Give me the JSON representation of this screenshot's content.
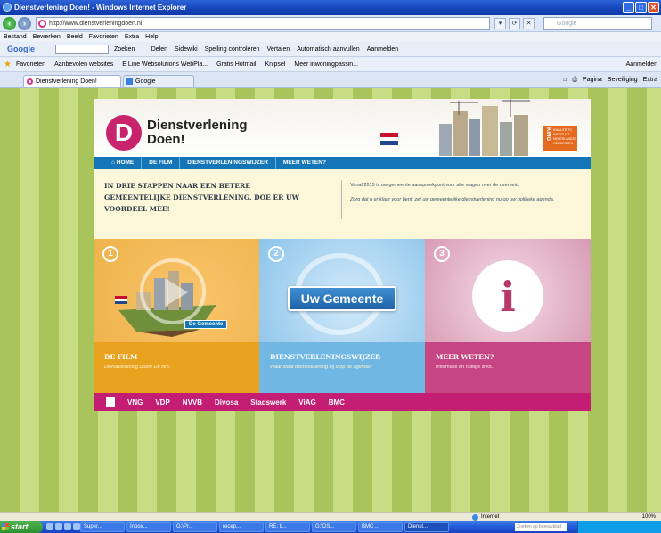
{
  "window": {
    "title": "Dienstverlening Doen! - Windows Internet Explorer",
    "min": "_",
    "max": "□",
    "close": "✕"
  },
  "addressbar": {
    "url": "http://www.dienstverleningdoen.nl",
    "search_placeholder": "Google",
    "buttons": [
      "▾",
      "⟳",
      "✕"
    ]
  },
  "menubar": {
    "items": [
      "Bestand",
      "Bewerken",
      "Beeld",
      "Favorieten",
      "Extra",
      "Help"
    ]
  },
  "google_toolbar": {
    "logo": "Google",
    "items": [
      "Zoeken",
      "·",
      "Delen",
      "Sidewiki",
      "Spelling controleren",
      "Vertalen",
      "Automatisch aanvullen",
      "Aanmelden"
    ]
  },
  "favorites_bar": {
    "label": "Favorieten",
    "items": [
      "Aanbevolen websites",
      "E Line Websolutions WebPla...",
      "Gratis Hotmail",
      "Knipsel",
      "Meer inwoningpassin..."
    ],
    "right_items": [
      "Aanmelden"
    ]
  },
  "tabs": [
    {
      "label": "Dienstverlening Doen!",
      "active": true
    },
    {
      "label": "Google",
      "active": false
    }
  ],
  "command_bar": {
    "items": [
      "Pagina",
      "Beveiliging",
      "Extra"
    ]
  },
  "site": {
    "logo_letter": "D",
    "logo_line1": "Dienstverlening",
    "logo_line2": "Doen!",
    "king": {
      "letters": "KING",
      "sub": [
        "KWALITEITS",
        "INSTITUUT",
        "NEDERLANDSE",
        "GEMEENTEN"
      ]
    },
    "nav": [
      "HOME",
      "DE FILM",
      "DIENSTVERLENINGSWIJZER",
      "MEER WETEN?"
    ],
    "nav_home_icon": "⌂",
    "intro_headline": "IN DRIE STAPPEN NAAR EEN BETERE GEMEENTELIJKE DIENSTVERLENING. DOE ER UW VOORDEEL MEE!",
    "intro_p1": "Vanaf 2015 is uw gemeente aanspreekpunt voor alle vragen over de overheid.",
    "intro_p2": "Zorg dat u er klaar voor bent: zet uw gemeentelijke dienstverlening nu op uw politieke agenda.",
    "panels": [
      {
        "num": "1",
        "title": "DE FILM",
        "sub": "Dienstverlening Doen! De film.",
        "tag": "De Gemeente"
      },
      {
        "num": "2",
        "title": "DIENSTVERLENINGSWIJZER",
        "sub": "Waar staat dienstverlening bij u op de agenda?",
        "button": "Uw Gemeente"
      },
      {
        "num": "3",
        "title": "MEER WETEN?",
        "sub": "Informatie en nuttige links.",
        "icon": "i"
      }
    ],
    "partners": [
      "VNG",
      "VDP",
      "NVVB",
      "Divosa",
      "Stadswerk",
      "ViAG",
      "BMC"
    ]
  },
  "statusbar": {
    "zone": "Internet",
    "zoom": "100%"
  },
  "taskbar": {
    "start": "start",
    "items": [
      "Super...",
      "Inbox...",
      "G:\\Pr...",
      "recep...",
      "RE: ti...",
      "G:\\DS...",
      "BMC ...",
      "Dienst..."
    ],
    "search": "Zoeken op bureaublad",
    "clock": ""
  },
  "colors": {
    "brand_magenta": "#c41e74",
    "nav_blue": "#1476b8",
    "panel_orange": "#e9a21e",
    "panel_blue": "#71b7e3",
    "panel_pink": "#c54682",
    "stripe_green": "#a8c45a"
  }
}
